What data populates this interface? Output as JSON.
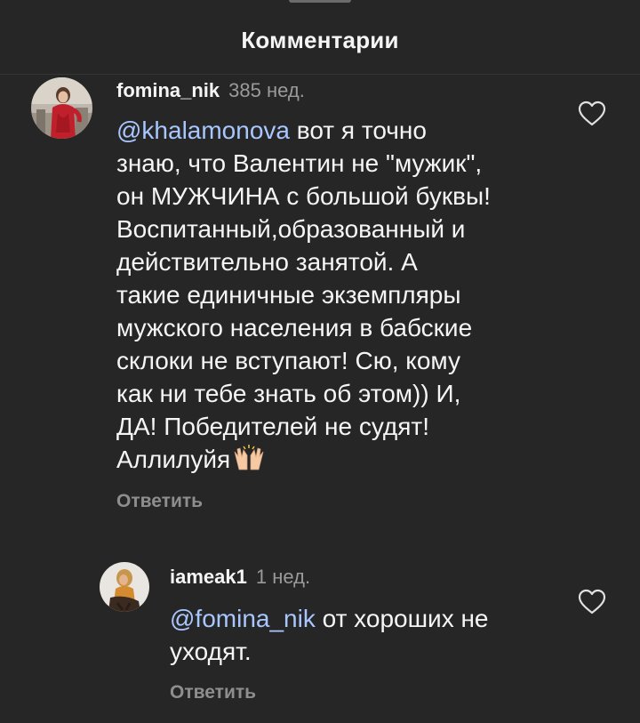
{
  "header": {
    "title": "Комментарии"
  },
  "comments": [
    {
      "username": "fomina_nik",
      "timestamp": "385 нед.",
      "mention": "@khalamonova",
      "lines": [
        " вот я точно",
        "знаю, что Валентин не \"мужик\",",
        "он МУЖЧИНА с большой буквы!",
        "Воспитанный,образованный и",
        "действительно занятой.  А",
        "такие единичные экземпляры",
        "мужского населения в бабские",
        "склоки не вступают! Сю, кому",
        "как ни тебе знать об этом)) И,",
        "ДА! Победителей не судят!",
        "Аллилуйя"
      ],
      "emoji": "raising-hands-icon",
      "reply_label": "Ответить",
      "like_icon": "heart-outline-icon"
    },
    {
      "username": "iameak1",
      "timestamp": "1 нед.",
      "mention": "@fomina_nik",
      "lines": [
        " от хороших не",
        "уходят."
      ],
      "reply_label": "Ответить",
      "like_icon": "heart-outline-icon"
    }
  ],
  "colors": {
    "background": "#262626",
    "text": "#f5f5f5",
    "mention": "#a8c7ff",
    "muted": "#8e8e8e"
  }
}
